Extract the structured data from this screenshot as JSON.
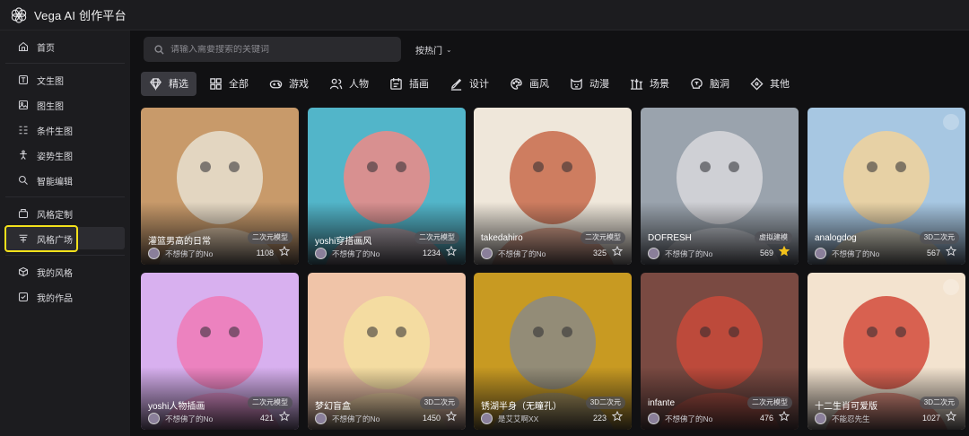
{
  "app": {
    "title": "Vega AI 创作平台"
  },
  "sidebar": {
    "groups": [
      [
        {
          "label": "首页",
          "icon": "home-icon"
        }
      ],
      [
        {
          "label": "文生图",
          "icon": "text-image-icon"
        },
        {
          "label": "图生图",
          "icon": "image-icon"
        },
        {
          "label": "条件生图",
          "icon": "conditions-icon"
        },
        {
          "label": "姿势生图",
          "icon": "pose-icon"
        },
        {
          "label": "智能编辑",
          "icon": "edit-icon"
        }
      ],
      [
        {
          "label": "风格定制",
          "icon": "style-icon"
        },
        {
          "label": "风格广场",
          "icon": "plaza-icon",
          "active": true
        }
      ],
      [
        {
          "label": "我的风格",
          "icon": "cube-icon"
        },
        {
          "label": "我的作品",
          "icon": "works-icon"
        }
      ]
    ]
  },
  "search": {
    "placeholder": "请输入需要搜索的关键词"
  },
  "sort": {
    "label": "按热门"
  },
  "categories": [
    {
      "label": "精选",
      "icon": "gem-icon",
      "selected": true
    },
    {
      "label": "全部",
      "icon": "grid-icon"
    },
    {
      "label": "游戏",
      "icon": "gamepad-icon"
    },
    {
      "label": "人物",
      "icon": "people-icon"
    },
    {
      "label": "插画",
      "icon": "illustration-icon"
    },
    {
      "label": "设计",
      "icon": "design-icon"
    },
    {
      "label": "画风",
      "icon": "palette-icon"
    },
    {
      "label": "动漫",
      "icon": "anime-icon"
    },
    {
      "label": "场景",
      "icon": "scene-icon"
    },
    {
      "label": "脑洞",
      "icon": "brain-icon"
    },
    {
      "label": "其他",
      "icon": "other-icon"
    }
  ],
  "cards": [
    {
      "name": "灌篮男高的日常",
      "badge": "二次元模型",
      "author": "不想佛了的No",
      "count": "1108",
      "starred": false,
      "bg": "#c89a6a",
      "accent": "#e8e0d0"
    },
    {
      "name": "yoshi穿搭画风",
      "badge": "二次元模型",
      "author": "不想佛了的No",
      "count": "1234",
      "starred": false,
      "bg": "#52b5c9",
      "accent": "#f08a86"
    },
    {
      "name": "takedahiro",
      "badge": "二次元模型",
      "author": "不想佛了的No",
      "count": "325",
      "starred": false,
      "bg": "#efe7da",
      "accent": "#c86a4a"
    },
    {
      "name": "DOFRESH",
      "badge": "虚拟建模",
      "author": "不想佛了的No",
      "count": "569",
      "starred": true,
      "bg": "#9aa3ad",
      "accent": "#d8d8dc"
    },
    {
      "name": "analogdog",
      "badge": "3D二次元",
      "author": "不想佛了的No",
      "count": "567",
      "starred": false,
      "bg": "#a7c7e2",
      "accent": "#f2d29a"
    },
    {
      "name": "yoshi人物插画",
      "badge": "二次元模型",
      "author": "不想佛了的No",
      "count": "421",
      "starred": false,
      "bg": "#d8b0ef",
      "accent": "#f07ab6"
    },
    {
      "name": "梦幻盲盒",
      "badge": "3D二次元",
      "author": "不想佛了的No",
      "count": "1450",
      "starred": false,
      "bg": "#f0c4a8",
      "accent": "#f5e0a0"
    },
    {
      "name": "锈湖半身（无瞳孔）",
      "badge": "3D二次元",
      "author": "是艾艾啊XX",
      "count": "223",
      "starred": false,
      "bg": "#c89a22",
      "accent": "#8a8a86"
    },
    {
      "name": "infante",
      "badge": "二次元模型",
      "author": "不想佛了的No",
      "count": "476",
      "starred": false,
      "bg": "#7a4a42",
      "accent": "#c94a3a"
    },
    {
      "name": "十二生肖可爱版",
      "badge": "3D二次元",
      "author": "不能忍先生",
      "count": "1027",
      "starred": false,
      "bg": "#f3e3cf",
      "accent": "#d24a3a"
    }
  ],
  "colors": {
    "selection_highlight": "#f3e11b",
    "star_active": "#f3c21b"
  }
}
